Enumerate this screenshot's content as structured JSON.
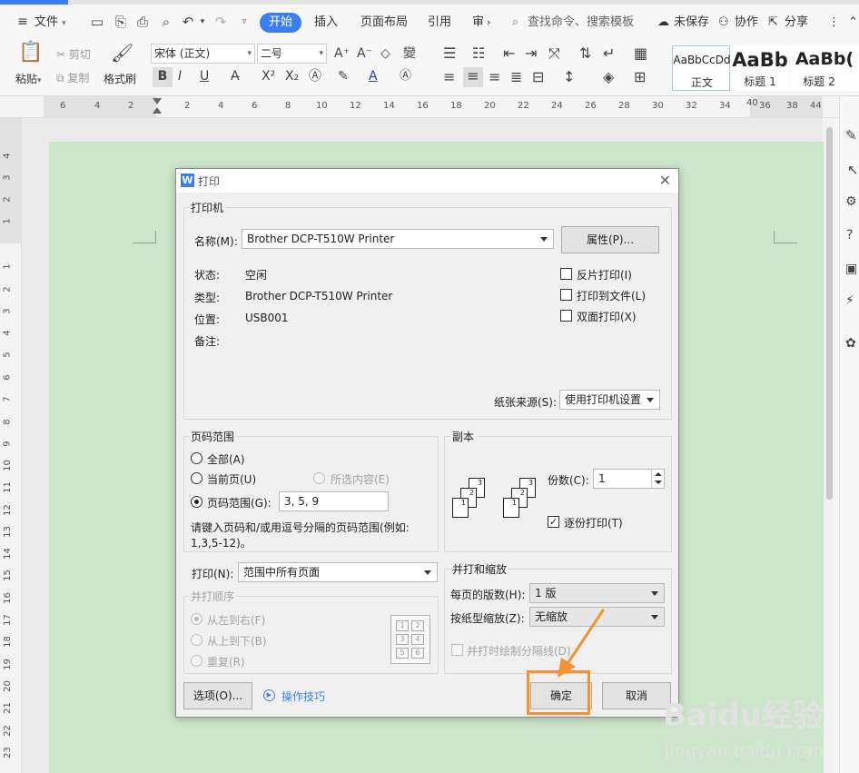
{
  "menubar": {
    "file_label": "文件",
    "tabs": [
      "开始",
      "插入",
      "页面布局",
      "引用",
      "审"
    ],
    "search_placeholder": "查找命令、搜索模板",
    "unsaved_label": "未保存",
    "collab_label": "协作",
    "share_label": "分享"
  },
  "ribbon": {
    "paste_label": "粘贴",
    "cut_label": "剪切",
    "copy_label": "复制",
    "format_painter_label": "格式刷",
    "font_name": "宋体 (正文)",
    "font_size": "二号",
    "styles": [
      {
        "preview": "AaBbCcDd",
        "label": "正文"
      },
      {
        "preview": "AaBb",
        "label": "标题 1"
      },
      {
        "preview": "AaBb(",
        "label": "标题 2"
      }
    ]
  },
  "ruler": {
    "h_labels": [
      "6",
      "4",
      "2",
      "2",
      "4",
      "6",
      "8",
      "10",
      "12",
      "14",
      "16",
      "18",
      "20",
      "22",
      "24",
      "26",
      "28",
      "30",
      "32",
      "34",
      "36",
      "38",
      "40",
      "44"
    ],
    "v_labels": [
      "4",
      "3",
      "2",
      "1",
      "1",
      "2",
      "3",
      "4",
      "5",
      "6",
      "7",
      "8",
      "9",
      "10",
      "11",
      "12",
      "13",
      "14",
      "15",
      "16",
      "17",
      "18",
      "19",
      "20",
      "21",
      "22",
      "23"
    ]
  },
  "dialog": {
    "title": "打印",
    "printer_group": "打印机",
    "name_label": "名称(M):",
    "printer_name": "Brother DCP-T510W Printer",
    "properties_button": "属性(P)...",
    "status_label": "状态:",
    "status_value": "空闲",
    "type_label": "类型:",
    "type_value": "Brother DCP-T510W Printer",
    "location_label": "位置:",
    "location_value": "USB001",
    "comment_label": "备注:",
    "reverse_print": "反片打印(I)",
    "print_to_file": "打印到文件(L)",
    "duplex_print": "双面打印(X)",
    "paper_source_label": "纸张来源(S):",
    "paper_source_value": "使用打印机设置",
    "page_range_group": "页码范围",
    "all_pages": "全部(A)",
    "current_page": "当前页(U)",
    "selection": "所选内容(E)",
    "page_range": "页码范围(G):",
    "page_range_value": "3, 5, 9",
    "hint": "请键入页码和/或用逗号分隔的页码范围(例如:",
    "hint2": "1,3,5-12)。",
    "copies_group": "副本",
    "copies_label": "份数(C):",
    "copies_value": "1",
    "collate_label": "逐份打印(T)",
    "print_label": "打印(N):",
    "print_value": "范围中所有页面",
    "order_group": "并打顺序",
    "order_ltr": "从左到右(F)",
    "order_ttb": "从上到下(B)",
    "order_repeat": "重复(R)",
    "scale_group": "并打和缩放",
    "pages_per_sheet_label": "每页的版数(H):",
    "pages_per_sheet_value": "1 版",
    "scale_label": "按纸型缩放(Z):",
    "scale_value": "无缩放",
    "draw_separator": "并打时绘制分隔线(D)",
    "options_button": "选项(O)...",
    "tips_link": "操作技巧",
    "ok_button": "确定",
    "cancel_button": "取消"
  },
  "watermark": {
    "brand": "Baidu经验",
    "url": "jingyan.baidu.com"
  },
  "colors": {
    "accent": "#3d7df3",
    "page": "#cde6cb",
    "highlight": "#f5922f"
  }
}
